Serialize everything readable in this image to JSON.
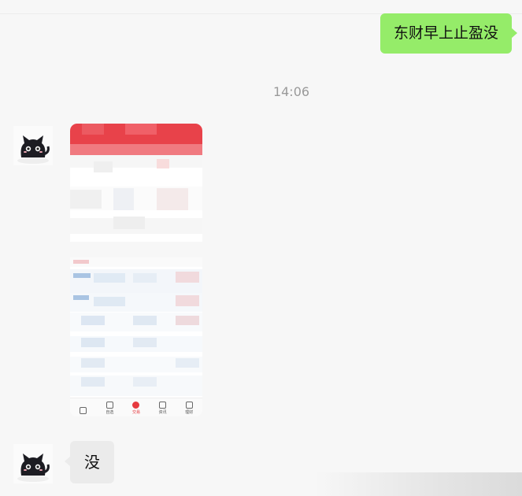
{
  "messages": {
    "outgoing_text": "东财早上止盈没",
    "timestamp": "14:06",
    "incoming_image": {
      "kind": "screenshot",
      "tab_bar": [
        "",
        "自选",
        "交易",
        "资讯",
        "理财"
      ],
      "active_tab": "交易"
    },
    "incoming_text": "没"
  },
  "colors": {
    "outgoing_bubble": "#95ec69",
    "incoming_bubble": "#ebebeb",
    "background": "#f7f7f7",
    "image_header": "#e63a3f"
  },
  "icons": {
    "avatar": "black-cat-avatar"
  }
}
